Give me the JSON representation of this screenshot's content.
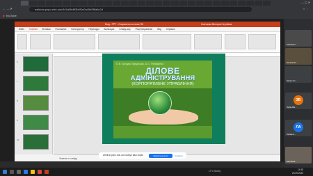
{
  "browser": {
    "tab_label": "YouTube",
    "url": "webinar.pnpu.edu.ua/c/b/1a5fe6f3b8f1e0a40e5f8a6c2d",
    "bookmarks_label": "YouTube"
  },
  "ppt": {
    "title": "Вхід - PPT - Сохранено на этом ПК",
    "user": "Сметанко Вікторія Сергіївна",
    "menu": [
      "Файл",
      "Главная",
      "Вставка",
      "Рисование",
      "Конструктор",
      "Переходы",
      "Анимация",
      "Слайд-шоу",
      "Рецензирование",
      "Вид",
      "Справка"
    ],
    "active_menu": "Главная",
    "notes_placeholder": "Заметки к слайду",
    "slide_numbers": [
      "6",
      "7",
      "8",
      "9",
      "10"
    ]
  },
  "slide": {
    "authors": "О.В. Бондар-Підгурська, А.О. Гнибіденко",
    "title_line1": "ДІЛОВЕ",
    "title_line2": "АДМІНІСТРУВАННЯ",
    "subtitle": "(КОРПОРАТИВНЕ УПРАВЛІННЯ)"
  },
  "share_bar": {
    "message": "webinar.pnpu.edu.ua показує ваш екран",
    "share_button": "Закрити доступ",
    "hide_button": "Сховати"
  },
  "participants": [
    {
      "name": "Сметанко...",
      "initials": "",
      "color": "#3c4043"
    },
    {
      "name": "Оксана Ю...",
      "initials": "",
      "color": "#3c4043"
    },
    {
      "name": "Зорян Ол...",
      "initials": "",
      "color": "#3c4043"
    },
    {
      "name": "Зубко Вік...",
      "initials": "ЗВ",
      "color": "#e8710a"
    },
    {
      "name": "Лісова А...",
      "initials": "ЛА",
      "color": "#1a73e8"
    },
    {
      "name": "Катерина...",
      "initials": "",
      "color": "#3c4043"
    }
  ],
  "taskbar": {
    "time": "14:15",
    "date": "26.09.2023",
    "status": "17°C Sunny"
  }
}
